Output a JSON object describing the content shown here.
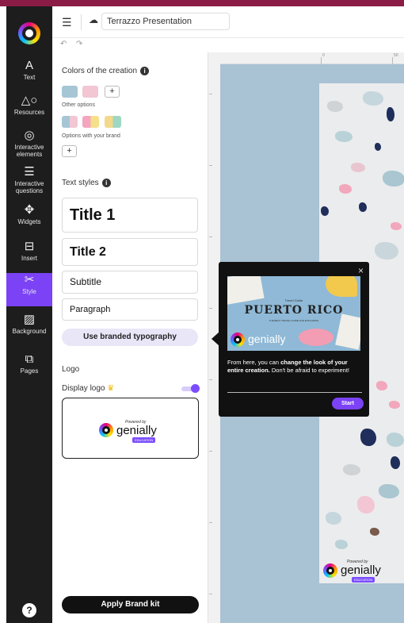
{
  "colors": {
    "topstrip": "#8a1c46",
    "rail_bg": "#1d1d1d",
    "accent": "#7b42f6",
    "canvas_bg": "#a9c2d4"
  },
  "sidebar": {
    "items": [
      {
        "label": "Text",
        "icon": "text-icon"
      },
      {
        "label": "Resources",
        "icon": "shapes-icon"
      },
      {
        "label": "Interactive elements",
        "icon": "touch-icon"
      },
      {
        "label": "Interactive questions",
        "icon": "checklist-icon"
      },
      {
        "label": "Widgets",
        "icon": "puzzle-icon"
      },
      {
        "label": "Insert",
        "icon": "insert-icon"
      },
      {
        "label": "Style",
        "icon": "style-icon",
        "active": true
      },
      {
        "label": "Background",
        "icon": "pattern-icon"
      },
      {
        "label": "Pages",
        "icon": "pages-icon"
      }
    ],
    "help_label": "?"
  },
  "topbar": {
    "title_value": "Terrazzo Presentation",
    "undo_icon": "undo-icon",
    "redo_icon": "redo-icon"
  },
  "panel": {
    "colors_title": "Colors of the creation",
    "info_glyph": "i",
    "other_options": "Other options",
    "brand_options": "Options with your brand",
    "plus": "+",
    "text_styles_title": "Text styles",
    "styles": {
      "title1": "Title 1",
      "title2": "Title 2",
      "subtitle": "Subtitle",
      "paragraph": "Paragraph"
    },
    "use_branded_typography": "Use branded typography",
    "logo_title": "Logo",
    "display_logo": "Display logo",
    "display_logo_on": true,
    "logo_preview": {
      "powered_by": "Powered by",
      "wordmark": "genially",
      "edition": "EDUCATION"
    },
    "apply_brand_kit": "Apply Brand kit"
  },
  "ruler": {
    "top_labels": [
      "0",
      "50"
    ],
    "side_labels": [
      "0",
      "50",
      "100",
      "150",
      "200",
      "250",
      "300",
      "350"
    ]
  },
  "slide_brand": {
    "powered_by": "Powered by",
    "wordmark": "genially",
    "edition": "EDUCATION"
  },
  "tooltip": {
    "close": "×",
    "preview": {
      "small_heading": "Travel Guide",
      "heading": "PUERTO RICO",
      "tagline": "THE BEST TRAVEL GUIDE FOR EXPLORING",
      "wordmark": "genially"
    },
    "text_before": "From here, you can ",
    "text_bold": "change the look of your entire creation.",
    "text_after": " Don't be afraid to experiment!",
    "start_label": "Start"
  }
}
